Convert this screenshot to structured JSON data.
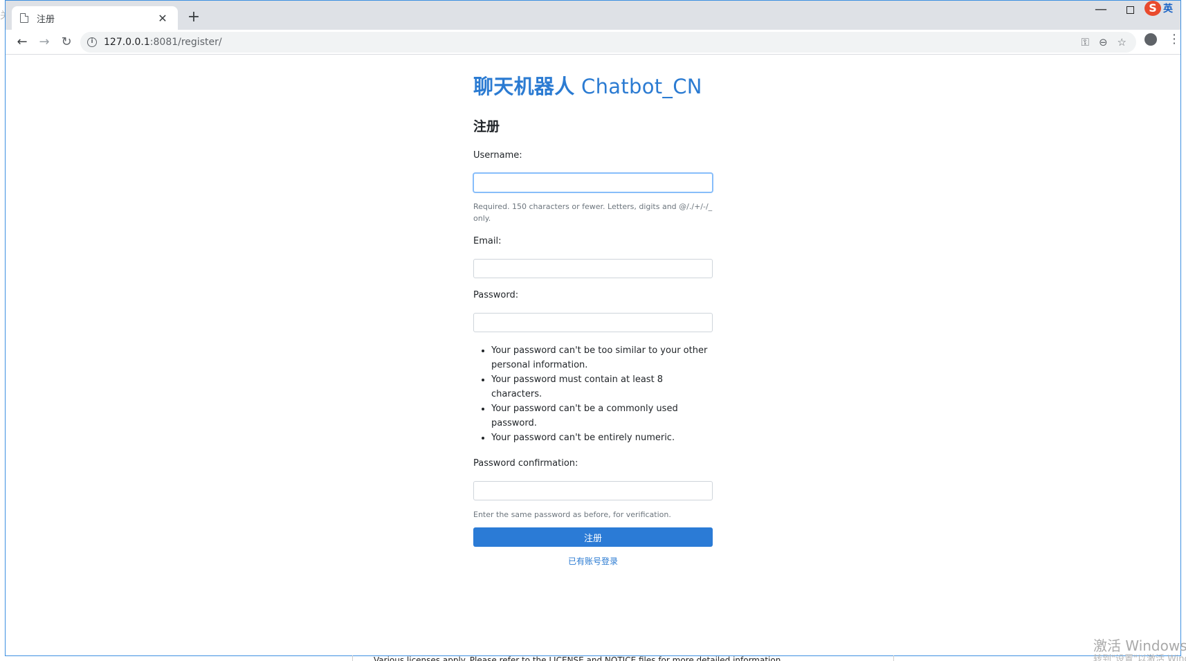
{
  "desktop": {
    "left_glyph": "关"
  },
  "browser": {
    "tab": {
      "title": "注册",
      "close_glyph": "✕"
    },
    "new_tab_glyph": "+",
    "window_controls": {
      "minimize_glyph": "—"
    },
    "ime": {
      "badge": "S",
      "mode": "英"
    },
    "nav": {
      "back_glyph": "←",
      "forward_glyph": "→",
      "reload_glyph": "↻"
    },
    "url": {
      "host": "127.0.0.1",
      "rest": ":8081/register/"
    },
    "info_glyph": "i",
    "omnibox_icons": {
      "key": "⚿",
      "zoom": "⊖",
      "star": "☆"
    },
    "menu_glyph": "⋮"
  },
  "page": {
    "site_title_cn": "聊天机器人",
    "site_title_en": " Chatbot_CN",
    "form_heading": "注册",
    "fields": {
      "username_label": "Username:",
      "username_help": "Required. 150 characters or fewer. Letters, digits and @/./+/-/_ only.",
      "email_label": "Email:",
      "password_label": "Password:",
      "password_rules": [
        "Your password can't be too similar to your other personal information.",
        "Your password must contain at least 8 characters.",
        "Your password can't be a commonly used password.",
        "Your password can't be entirely numeric."
      ],
      "password_confirm_label": "Password confirmation:",
      "password_confirm_help": "Enter the same password as before, for verification."
    },
    "submit_label": "注册",
    "login_link": "已有账号登录"
  },
  "footer": {
    "license": "Various licenses apply. Please refer to the LICENSE and NOTICE files for more detailed information.",
    "watermark": "激活 Windows",
    "watermark_sub": "转到\"设置\"以激活 Windows。"
  },
  "colors": {
    "accent": "#2b7bd2",
    "button": "#2b7bd6",
    "frame": "#3c8fe0"
  }
}
